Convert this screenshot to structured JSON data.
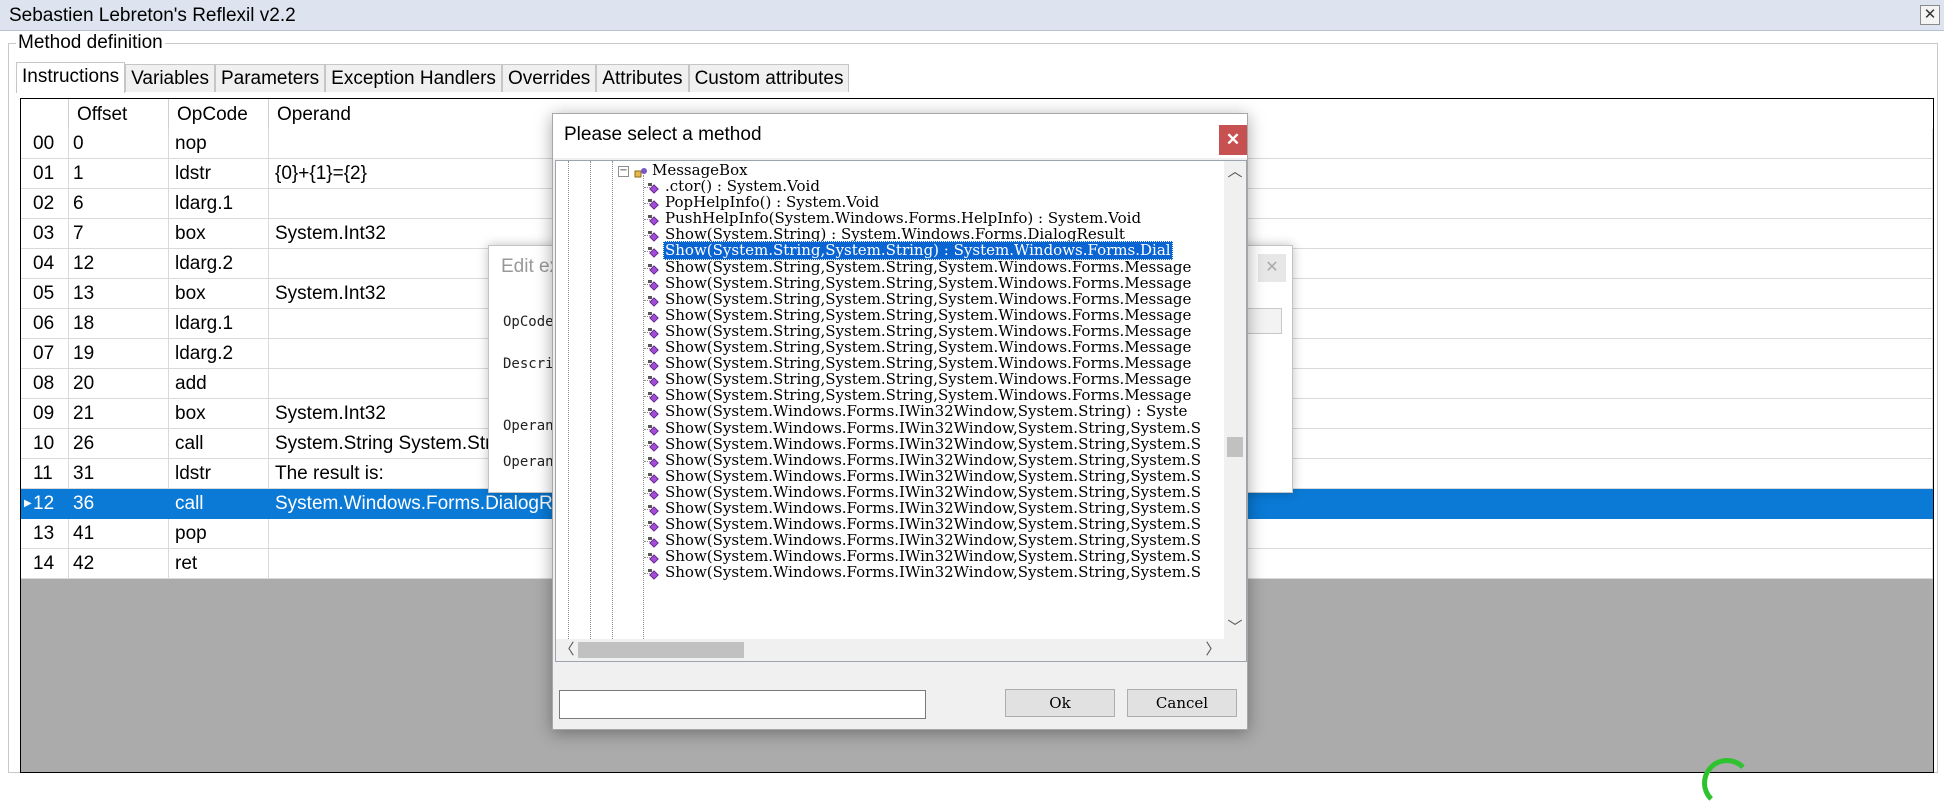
{
  "window": {
    "title": "Sebastien Lebreton's Reflexil v2.2",
    "close_glyph": "✕"
  },
  "group": {
    "label": "Method definition"
  },
  "tabs": [
    "Instructions",
    "Variables",
    "Parameters",
    "Exception Handlers",
    "Overrides",
    "Attributes",
    "Custom attributes"
  ],
  "grid": {
    "columns": [
      "",
      "Offset",
      "OpCode",
      "Operand"
    ],
    "rows": [
      {
        "index": "00",
        "offset": "0",
        "opcode": "nop",
        "operand": ""
      },
      {
        "index": "01",
        "offset": "1",
        "opcode": "ldstr",
        "operand": "{0}+{1}={2}"
      },
      {
        "index": "02",
        "offset": "6",
        "opcode": "ldarg.1",
        "operand": ""
      },
      {
        "index": "03",
        "offset": "7",
        "opcode": "box",
        "operand": "System.Int32"
      },
      {
        "index": "04",
        "offset": "12",
        "opcode": "ldarg.2",
        "operand": ""
      },
      {
        "index": "05",
        "offset": "13",
        "opcode": "box",
        "operand": "System.Int32"
      },
      {
        "index": "06",
        "offset": "18",
        "opcode": "ldarg.1",
        "operand": ""
      },
      {
        "index": "07",
        "offset": "19",
        "opcode": "ldarg.2",
        "operand": ""
      },
      {
        "index": "08",
        "offset": "20",
        "opcode": "add",
        "operand": ""
      },
      {
        "index": "09",
        "offset": "21",
        "opcode": "box",
        "operand": "System.Int32"
      },
      {
        "index": "10",
        "offset": "26",
        "opcode": "call",
        "operand": "System.String System.Stri"
      },
      {
        "index": "11",
        "offset": "31",
        "opcode": "ldstr",
        "operand": "The result is:"
      },
      {
        "index": "12",
        "offset": "36",
        "opcode": "call",
        "operand": "System.Windows.Forms.DialogRe",
        "selected": true
      },
      {
        "index": "13",
        "offset": "41",
        "opcode": "pop",
        "operand": ""
      },
      {
        "index": "14",
        "offset": "42",
        "opcode": "ret",
        "operand": ""
      }
    ]
  },
  "edit_dialog": {
    "title": "Edit ex",
    "close_glyph": "✕",
    "labels": [
      "OpCode",
      "Descri",
      "Operan",
      "Operan"
    ]
  },
  "select_dialog": {
    "title": "Please select a method",
    "close_glyph": "✕",
    "tree_root": "MessageBox",
    "methods": [
      ".ctor() : System.Void",
      "PopHelpInfo() : System.Void",
      "PushHelpInfo(System.Windows.Forms.HelpInfo) : System.Void",
      "Show(System.String) : System.Windows.Forms.DialogResult",
      "Show(System.String,System.String) : System.Windows.Forms.Dial",
      "Show(System.String,System.String,System.Windows.Forms.Message",
      "Show(System.String,System.String,System.Windows.Forms.Message",
      "Show(System.String,System.String,System.Windows.Forms.Message",
      "Show(System.String,System.String,System.Windows.Forms.Message",
      "Show(System.String,System.String,System.Windows.Forms.Message",
      "Show(System.String,System.String,System.Windows.Forms.Message",
      "Show(System.String,System.String,System.Windows.Forms.Message",
      "Show(System.String,System.String,System.Windows.Forms.Message",
      "Show(System.String,System.String,System.Windows.Forms.Message",
      "Show(System.Windows.Forms.IWin32Window,System.String) : Syste",
      "Show(System.Windows.Forms.IWin32Window,System.String,System.S",
      "Show(System.Windows.Forms.IWin32Window,System.String,System.S",
      "Show(System.Windows.Forms.IWin32Window,System.String,System.S",
      "Show(System.Windows.Forms.IWin32Window,System.String,System.S",
      "Show(System.Windows.Forms.IWin32Window,System.String,System.S",
      "Show(System.Windows.Forms.IWin32Window,System.String,System.S",
      "Show(System.Windows.Forms.IWin32Window,System.String,System.S",
      "Show(System.Windows.Forms.IWin32Window,System.String,System.S",
      "Show(System.Windows.Forms.IWin32Window,System.String,System.S",
      "Show(System.Windows.Forms.IWin32Window,System.String,System.S"
    ],
    "selected_method_index": 4,
    "search_value": "",
    "ok_label": "Ok",
    "cancel_label": "Cancel",
    "scroll_up": "︿",
    "scroll_down": "﹀",
    "scroll_left": "〈",
    "scroll_right": "〉"
  },
  "colors": {
    "selection": "#0a7ad6",
    "tree_selection": "#0a64d2",
    "close_button": "#c75050"
  }
}
